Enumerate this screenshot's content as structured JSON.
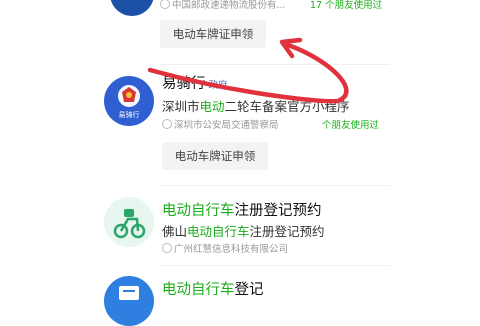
{
  "top_card": {
    "meta": "中国邮政速递物流股份有...",
    "meta_right": "17 个朋友使用过",
    "button_label": "电动车牌证申领"
  },
  "card_yiqixing": {
    "title": "易骑行",
    "tag": "政府",
    "sub_prefix": "深圳市",
    "sub_hl": "电动",
    "sub_rest": "二轮车备案官方小程序",
    "meta": "深圳市公安局交通警察局",
    "meta_right": "个朋友使用过",
    "avatar_text": "易骑行",
    "button_label": "电动车牌证申领"
  },
  "card_foshan": {
    "title_hl": "电动自行车",
    "title_rest": "注册登记预约",
    "sub_prefix": "佛山",
    "sub_hl": "电动自行车",
    "sub_rest": "注册登记预约",
    "meta": "广州红慧信息科技有限公司"
  },
  "card_bottom": {
    "title_hl": "电动自行车",
    "title_rest": "登记"
  },
  "colors": {
    "accent_green": "#1aad19",
    "arrow_red": "#e0323c",
    "police_blue": "#2f5fd0"
  }
}
